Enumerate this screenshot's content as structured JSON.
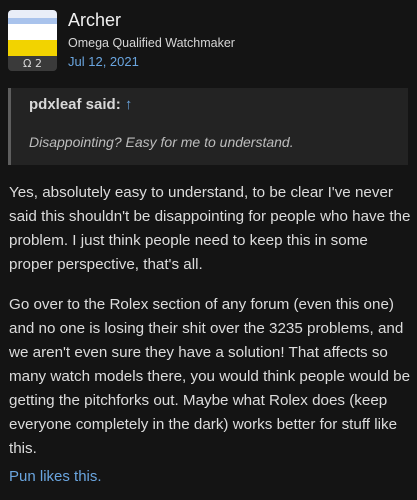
{
  "user": {
    "name": "Archer",
    "title": "Omega Qualified Watchmaker",
    "badge": "Ω 2",
    "date": "Jul 12, 2021"
  },
  "quote": {
    "author": "pdxleaf said:",
    "arrow": "↑",
    "text": "Disappointing? Easy for me to understand."
  },
  "body": {
    "paragraph1": "Yes, absolutely easy to understand, to be clear I've never said this shouldn't be disappointing for people who have the problem. I just think people need to keep this in some proper perspective, that's all.",
    "paragraph2": "Go over to the Rolex section of any forum (even this one) and no one is losing their shit over the 3235 problems, and we aren't even sure they have a solution! That affects so many watch models there, you would think people would be getting the pitchforks out. Maybe what Rolex does (keep everyone completely in the dark) works better for stuff like this."
  },
  "likes": "Pun likes this.",
  "colors": {
    "background": "#141414",
    "link": "#6aa5df",
    "quote_bg": "#232323"
  }
}
